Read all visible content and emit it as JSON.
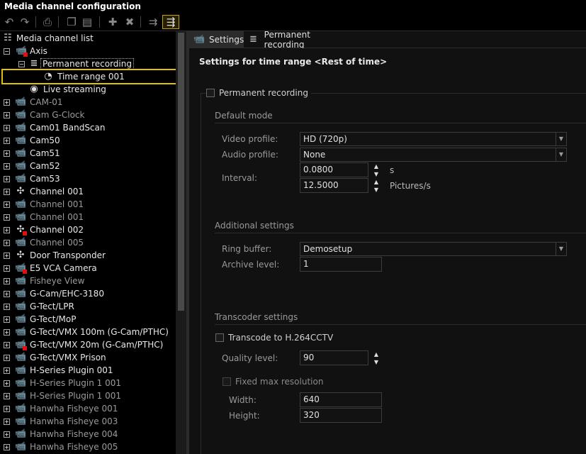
{
  "window": {
    "title": "Media channel configuration"
  },
  "toolbar": {
    "buttons": [
      "undo-icon",
      "redo-icon",
      "print-icon",
      "copy-icon",
      "paste-icon",
      "new-item-icon",
      "delete-icon",
      "sort-icon",
      "sort-active-icon"
    ]
  },
  "tree": {
    "root": "Media channel list",
    "axis": "Axis",
    "permanent_recording": "Permanent recording",
    "time_range": "Time range 001",
    "live_streaming": "Live streaming",
    "channels": [
      "CAM-01",
      "Cam G-Clock",
      "Cam01 BandScan",
      "Cam50",
      "Cam51",
      "Cam52",
      "Cam53",
      "Channel 001",
      "Channel 001",
      "Channel 001",
      "Channel 002",
      "Channel 005",
      "Door Transponder",
      "E5 VCA Camera",
      "Fisheye View",
      "G-Cam/EHC-3180",
      "G-Tect/LPR",
      "G-Tect/MoP",
      "G-Tect/VMX 100m (G-Cam/PTHC)",
      "G-Tect/VMX 20m (G-Cam/PTHC)",
      "G-Tect/VMX Prison",
      "H-Series Plugin 001",
      "H-Series Plugin 1 001",
      "H-Series Plugin 1 001",
      "Hanwha Fisheye 001",
      "Hanwha Fisheye 003",
      "Hanwha Fisheye 004",
      "Hanwha Fisheye 005"
    ]
  },
  "tabs": {
    "settings": "Settings",
    "permanent_recording": "Permanent recording"
  },
  "settings": {
    "heading": "Settings for time range <Rest of time>",
    "permanent_recording_label": "Permanent recording",
    "default_mode": {
      "title": "Default mode",
      "video_profile_label": "Video profile:",
      "video_profile_value": "HD (720p)",
      "audio_profile_label": "Audio profile:",
      "audio_profile_value": "None",
      "interval_label": "Interval:",
      "interval_seconds": "0.0800",
      "interval_seconds_unit": "s",
      "interval_pictures": "12.5000",
      "interval_pictures_unit": "Pictures/s"
    },
    "additional": {
      "title": "Additional settings",
      "ring_buffer_label": "Ring buffer:",
      "ring_buffer_value": "Demosetup",
      "archive_level_label": "Archive level:",
      "archive_level_value": "1"
    },
    "transcoder": {
      "title": "Transcoder settings",
      "transcode_label": "Transcode to H.264CCTV",
      "quality_label": "Quality level:",
      "quality_value": "90",
      "fixed_max_label": "Fixed max resolution",
      "width_label": "Width:",
      "width_value": "640",
      "height_label": "Height:",
      "height_value": "320"
    }
  }
}
